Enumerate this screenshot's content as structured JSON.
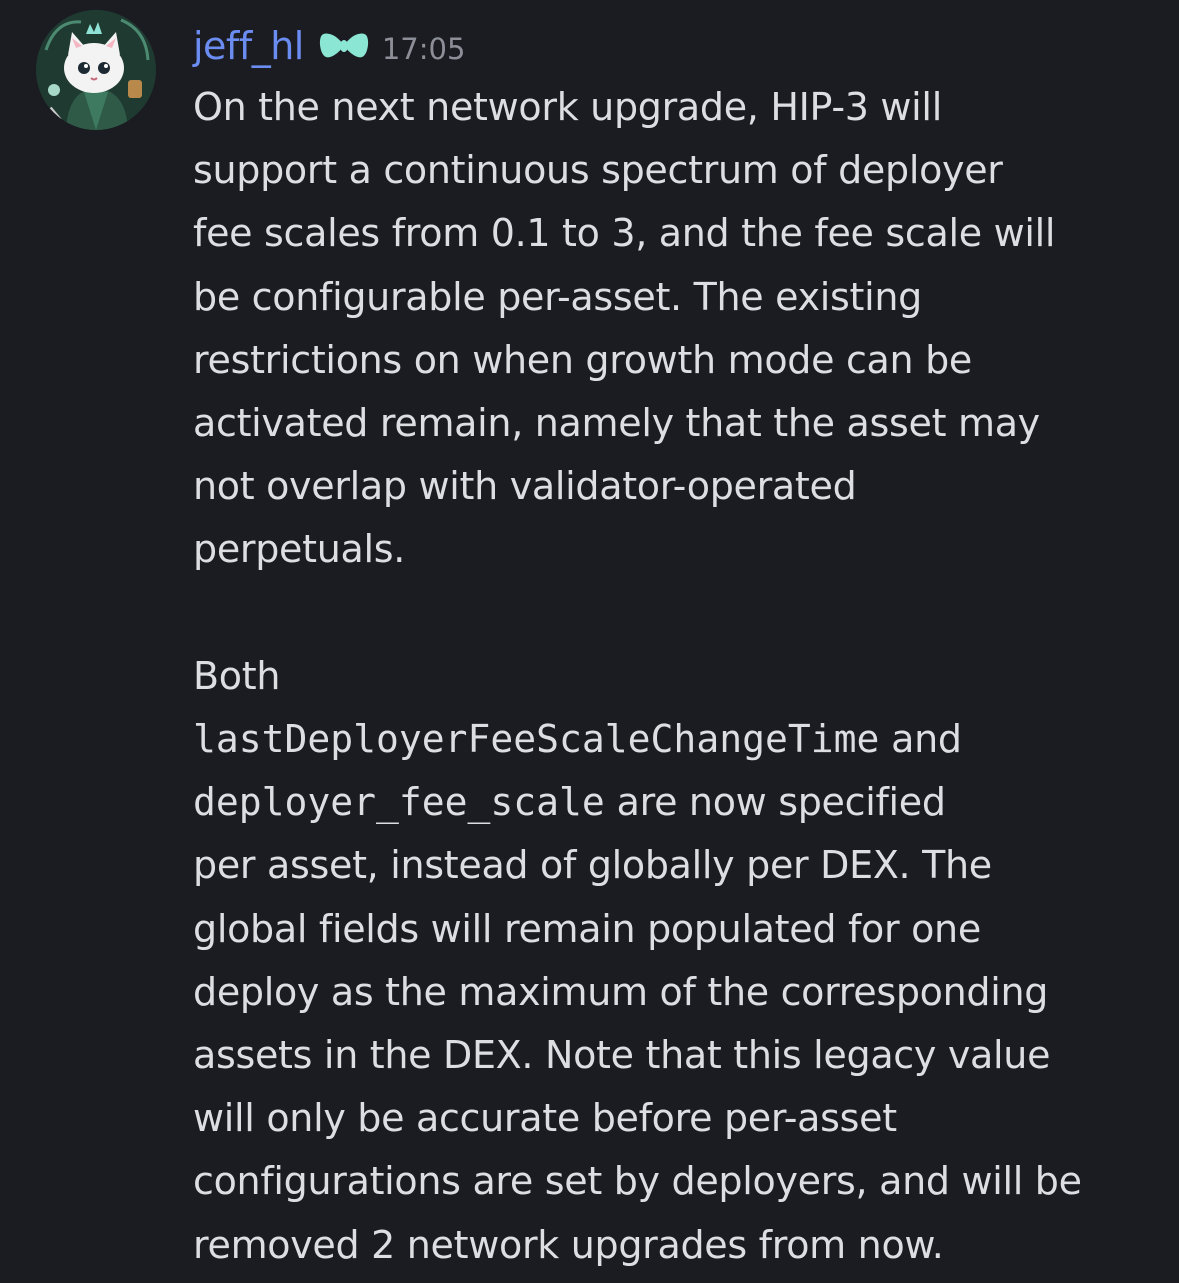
{
  "message": {
    "author": {
      "username": "jeff_hl",
      "role_icon": "butterfly-badge-icon",
      "role_icon_color": "#7fe0cf",
      "username_color": "#6b8cf0"
    },
    "timestamp": "17:05",
    "paragraph1": [
      "On the next network upgrade, HIP-3 will",
      "support a continuous spectrum of deployer",
      "fee scales from 0.1 to 3, and the fee scale will",
      "be configurable per-asset. The existing",
      "restrictions on when growth mode can be",
      "activated remain, namely that the asset may",
      "not overlap with validator-operated",
      "perpetuals."
    ],
    "paragraph2": {
      "line1": "Both",
      "code1": "lastDeployerFeeScaleChangeTime",
      "after_code1": " and",
      "code2": "deployer_fee_scale",
      "after_code2": " are now specified",
      "rest": [
        "per asset, instead of globally per DEX. The",
        "global fields will remain populated for one",
        "deploy as the maximum of the corresponding",
        "assets in the DEX. Note that this legacy value",
        "will only be accurate before per-asset",
        "configurations are set by deployers, and will be",
        "removed 2 network upgrades from now."
      ]
    }
  },
  "colors": {
    "background": "#1b1c21",
    "text": "#dddee2",
    "timestamp": "#8c8f97"
  }
}
